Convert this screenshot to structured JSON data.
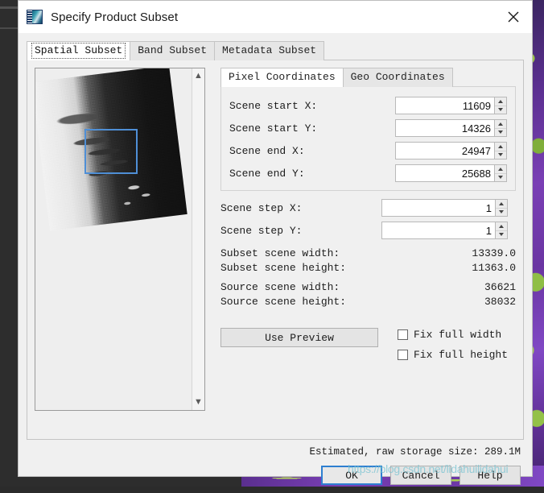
{
  "window": {
    "title": "Specify Product Subset",
    "app_icon": "snap-app-icon",
    "close_icon": "close-icon"
  },
  "main_tabs": [
    {
      "label": "Spatial Subset",
      "active": true
    },
    {
      "label": "Band Subset",
      "active": false
    },
    {
      "label": "Metadata Subset",
      "active": false
    }
  ],
  "preview": {
    "name": "scene-preview",
    "selection_rect": "selection-rectangle",
    "scroll_up_icon": "chevron-up-icon",
    "scroll_down_icon": "chevron-down-icon"
  },
  "coord_tabs": [
    {
      "label": "Pixel Coordinates",
      "active": true
    },
    {
      "label": "Geo Coordinates",
      "active": false
    }
  ],
  "fields": [
    {
      "label": "Scene start X:",
      "value": "11609",
      "name": "scene-start-x"
    },
    {
      "label": "Scene start Y:",
      "value": "14326",
      "name": "scene-start-y"
    },
    {
      "label": "Scene end X:",
      "value": "24947",
      "name": "scene-end-x"
    },
    {
      "label": "Scene end Y:",
      "value": "25688",
      "name": "scene-end-y"
    }
  ],
  "steps": [
    {
      "label": "Scene step X:",
      "value": "1",
      "name": "scene-step-x"
    },
    {
      "label": "Scene step Y:",
      "value": "1",
      "name": "scene-step-y"
    }
  ],
  "stats": [
    {
      "key": "Subset scene width:",
      "value": "13339.0"
    },
    {
      "key": "Subset scene height:",
      "value": "11363.0"
    },
    {
      "key": "Source scene width:",
      "value": "36621"
    },
    {
      "key": "Source scene height:",
      "value": "38032"
    }
  ],
  "use_preview_label": "Use Preview",
  "checkboxes": [
    {
      "label": "Fix full width",
      "checked": false,
      "name": "fix-full-width-checkbox"
    },
    {
      "label": "Fix full height",
      "checked": false,
      "name": "fix-full-height-checkbox"
    }
  ],
  "estimate_text": "Estimated, raw storage size: 289.1M",
  "buttons": [
    {
      "label": "OK",
      "default": true,
      "name": "ok-button"
    },
    {
      "label": "Cancel",
      "default": false,
      "name": "cancel-button"
    },
    {
      "label": "Help",
      "default": false,
      "name": "help-button"
    }
  ],
  "watermark": "https://blog.csdn.net/lidahuilidahui",
  "colors": {
    "accent": "#2e7fd1",
    "selection": "#4f8fd6",
    "dialog_bg": "#f0f0f0",
    "titlebar_bg": "#ffffff"
  }
}
